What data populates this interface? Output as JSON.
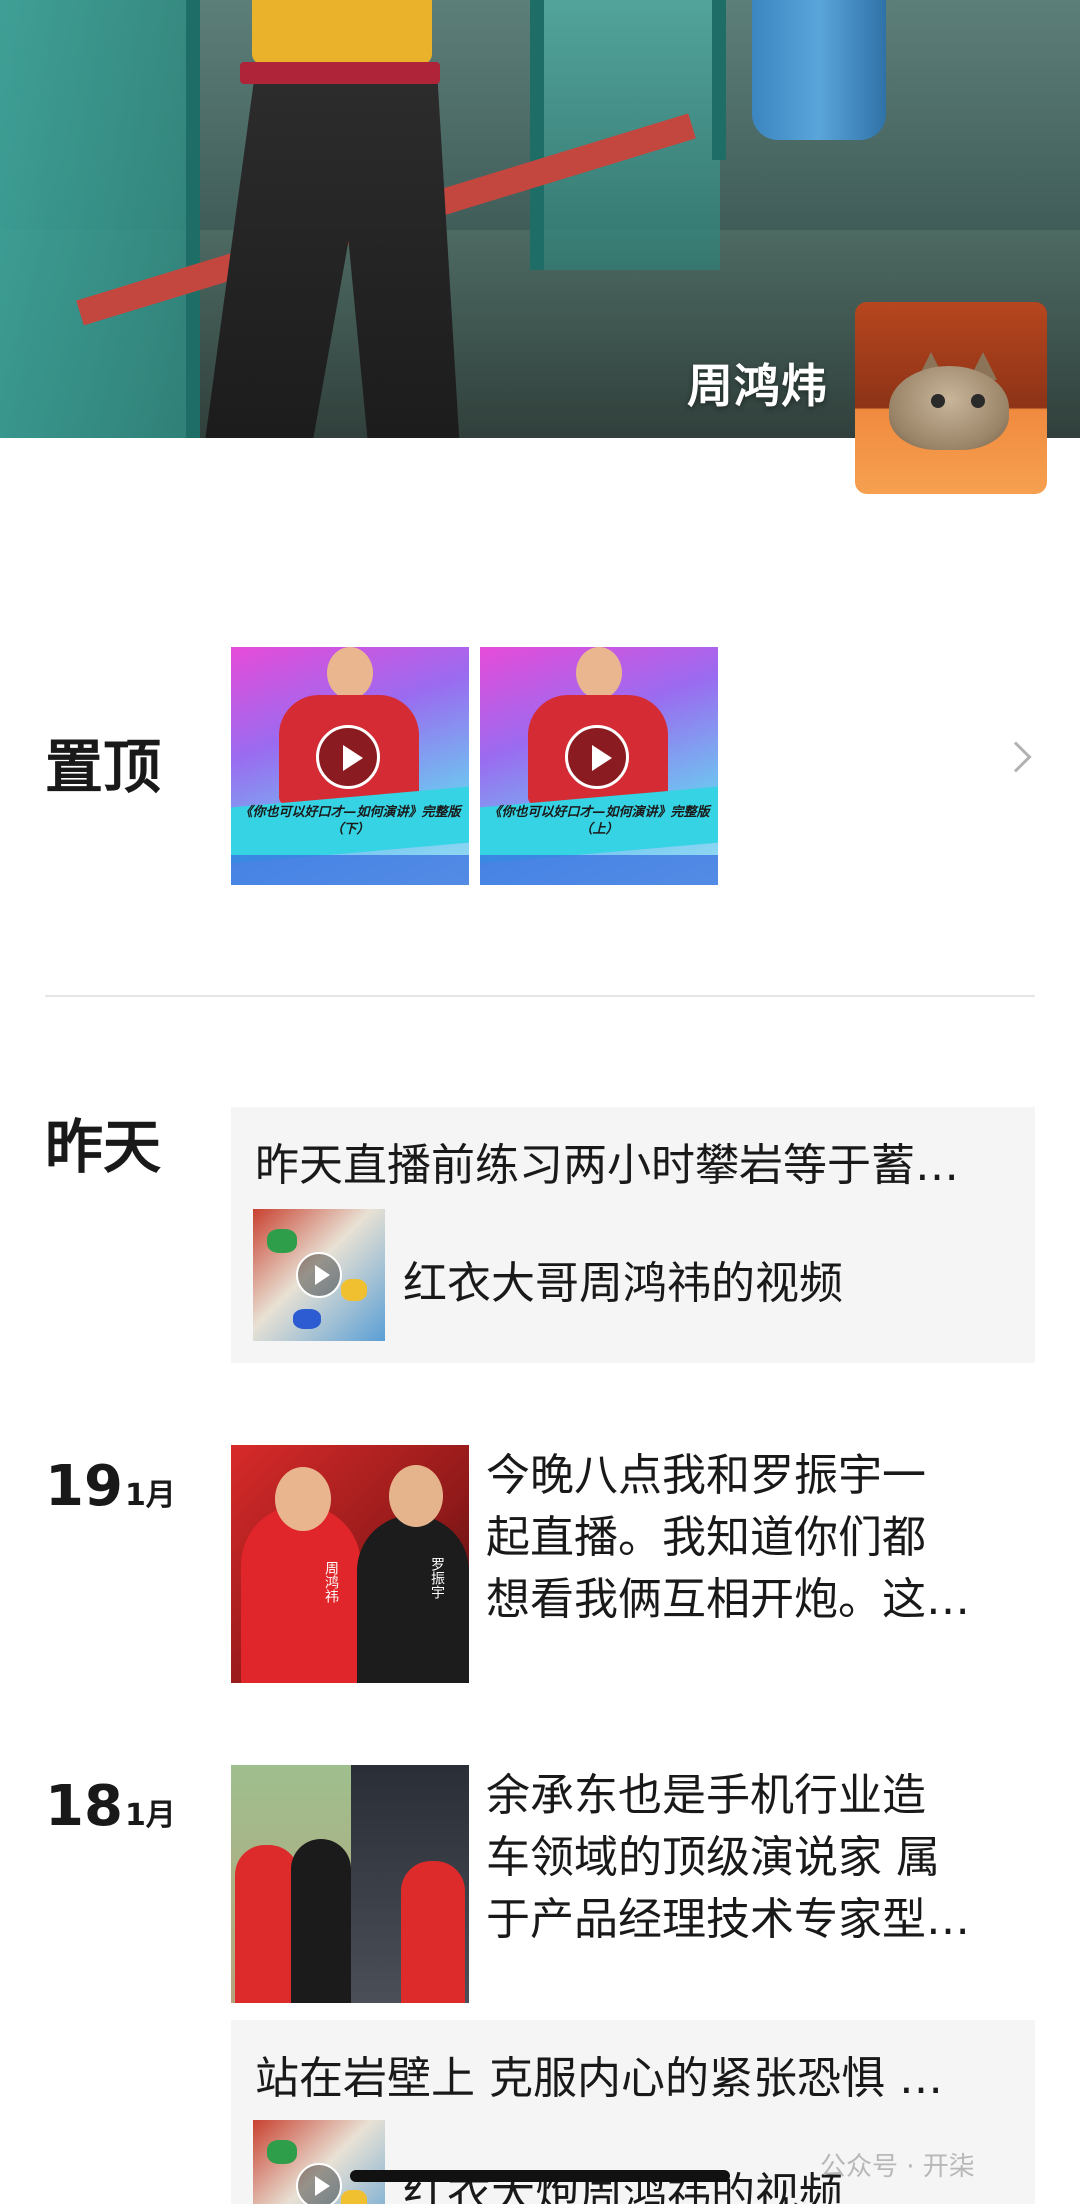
{
  "profile": {
    "name": "周鸿炜",
    "avatar_icon": "kitten-avatar"
  },
  "pinned": {
    "label": "置顶",
    "videos": [
      {
        "caption": "《你也可以好口才—如何演讲》完整版（下）",
        "icon": "play-icon"
      },
      {
        "caption": "《你也可以好口才—如何演讲》完整版（上）",
        "icon": "play-icon"
      }
    ],
    "chevron_icon": "chevron-right-icon"
  },
  "posts": [
    {
      "date_label": "昨天",
      "text": "昨天直播前练习两小时攀岩等于蓄…",
      "attachment_title": "红衣大哥周鸿祎的视频"
    },
    {
      "day": "19",
      "month": "1月",
      "lines": [
        "今晚八点我和罗振宇一",
        "起直播。我知道你们都",
        "想看我俩互相开炮。这…"
      ],
      "image_names": [
        "周鸿祎",
        "罗振宇"
      ]
    },
    {
      "day": "18",
      "month": "1月",
      "lines": [
        "余承东也是手机行业造",
        "车领域的顶级演说家 属",
        "于产品经理技术专家型…"
      ]
    },
    {
      "text": "站在岩壁上 克服内心的紧张恐惧 …",
      "attachment_title": "红衣大炮周鸿祎的视频"
    }
  ],
  "watermark": "公众号 · 开柒",
  "colors": {
    "card_bg": "#f5f5f5",
    "divider": "#e6e6e6",
    "text": "#191919"
  }
}
